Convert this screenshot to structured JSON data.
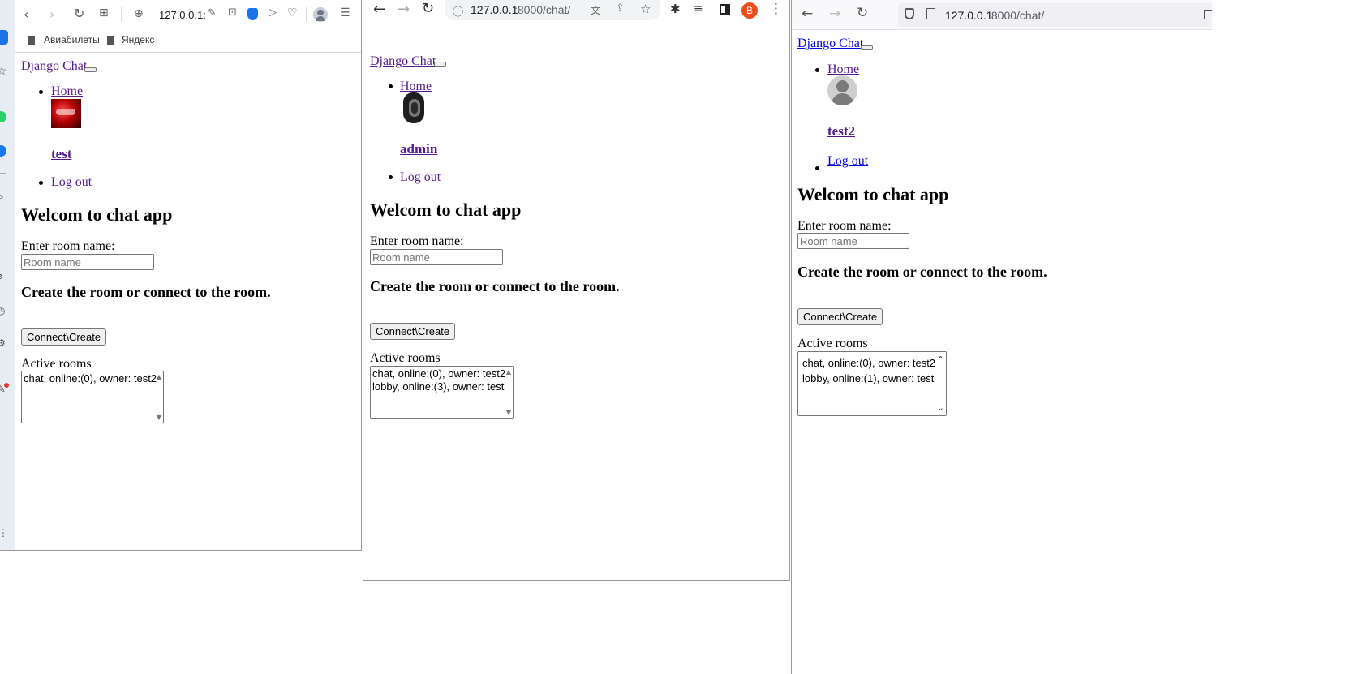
{
  "windows": [
    {
      "browser": "yandex",
      "address": "127.0.0.1:",
      "bookmarks": [
        "Авиабилеты",
        "Яндекс"
      ],
      "brand": "Django Chat",
      "nav": {
        "home": "Home",
        "username": "test",
        "logout": "Log out"
      },
      "heading": "Welcom to chat app",
      "room_label": "Enter room name:",
      "room_placeholder": "Room name",
      "subheading": "Create the room or connect to the room.",
      "button": "Connect\\Create",
      "active_label": "Active rooms",
      "rooms": [
        "chat, online:(0), owner: test2"
      ]
    },
    {
      "browser": "chrome",
      "address_host": "127.0.0.1",
      "address_path": ":8000/chat/",
      "profile_initial": "B",
      "brand": "Django Chat",
      "nav": {
        "home": "Home",
        "username": "admin",
        "logout": "Log out"
      },
      "heading": "Welcom to chat app",
      "room_label": "Enter room name:",
      "room_placeholder": "Room name",
      "subheading": "Create the room or connect to the room.",
      "button": "Connect\\Create",
      "active_label": "Active rooms",
      "rooms": [
        "chat, online:(0), owner: test2",
        "lobby, online:(3), owner: test"
      ]
    },
    {
      "browser": "firefox",
      "address_host": "127.0.0.1",
      "address_path": ":8000/chat/",
      "brand": "Django Chat",
      "nav": {
        "home": "Home",
        "username": "test2",
        "logout": "Log out"
      },
      "heading": "Welcom to chat app",
      "room_label": "Enter room name:",
      "room_placeholder": "Room name",
      "subheading": "Create the room or connect to the room.",
      "button": "Connect\\Create",
      "active_label": "Active rooms",
      "rooms": [
        "chat, online:(0), owner: test2",
        "lobby, online:(1), owner: test"
      ]
    }
  ],
  "colors": {
    "link_visited": "#551a8b",
    "link": "#0000ee",
    "chrome_profile": "#ea4e1a",
    "yandex_accent": "#1a73e8"
  }
}
